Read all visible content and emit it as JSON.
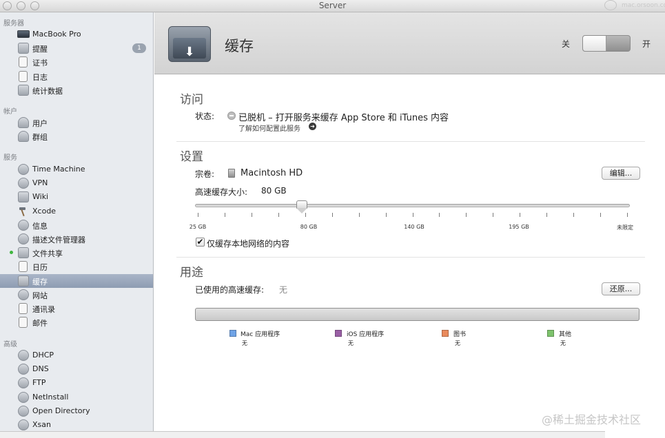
{
  "window": {
    "title": "Server",
    "watermark_logo_text": "mac.orsoon.com"
  },
  "sidebar": {
    "sections": [
      {
        "title": "服务器",
        "items": [
          {
            "label": "MacBook Pro",
            "icon": "laptop-icon"
          },
          {
            "label": "提醒",
            "icon": "megaphone-icon",
            "badge": "1"
          },
          {
            "label": "证书",
            "icon": "certificate-icon"
          },
          {
            "label": "日志",
            "icon": "log-icon"
          },
          {
            "label": "统计数据",
            "icon": "stats-icon"
          }
        ]
      },
      {
        "title": "帐户",
        "items": [
          {
            "label": "用户",
            "icon": "user-icon"
          },
          {
            "label": "群组",
            "icon": "group-icon"
          }
        ]
      },
      {
        "title": "服务",
        "items": [
          {
            "label": "Time Machine",
            "icon": "time-machine-icon"
          },
          {
            "label": "VPN",
            "icon": "vpn-icon"
          },
          {
            "label": "Wiki",
            "icon": "wiki-icon"
          },
          {
            "label": "Xcode",
            "icon": "hammer-icon"
          },
          {
            "label": "信息",
            "icon": "messages-icon"
          },
          {
            "label": "描述文件管理器",
            "icon": "profile-manager-icon"
          },
          {
            "label": "文件共享",
            "icon": "file-sharing-icon",
            "active_dot": true
          },
          {
            "label": "日历",
            "icon": "calendar-icon"
          },
          {
            "label": "缓存",
            "icon": "caching-icon",
            "selected": true
          },
          {
            "label": "网站",
            "icon": "globe-icon"
          },
          {
            "label": "通讯录",
            "icon": "contacts-icon"
          },
          {
            "label": "邮件",
            "icon": "mail-icon"
          }
        ]
      },
      {
        "title": "高级",
        "items": [
          {
            "label": "DHCP",
            "icon": "dhcp-icon"
          },
          {
            "label": "DNS",
            "icon": "dns-icon"
          },
          {
            "label": "FTP",
            "icon": "ftp-icon"
          },
          {
            "label": "NetInstall",
            "icon": "netinstall-icon"
          },
          {
            "label": "Open Directory",
            "icon": "open-directory-icon"
          },
          {
            "label": "Xsan",
            "icon": "xsan-icon"
          }
        ]
      }
    ]
  },
  "header": {
    "title": "缓存",
    "icon": "caching-download-icon",
    "switch_off_label": "关",
    "switch_on_label": "开",
    "switch_state": "off"
  },
  "access": {
    "heading": "访问",
    "status_label": "状态:",
    "status_text": "已脱机 – 打开服务来缓存 App Store 和 iTunes 内容",
    "help_link": "了解如何配置此服务"
  },
  "settings": {
    "heading": "设置",
    "volume_label": "宗卷:",
    "volume_value": "Macintosh HD",
    "edit_button": "编辑...",
    "cache_size_label": "高速缓存大小:",
    "cache_size_value": "80 GB",
    "slider_value_gb": 80,
    "slider_min_gb": 25,
    "slider_max_label": "未限定",
    "slider_labels": [
      "25 GB",
      "80 GB",
      "140 GB",
      "195 GB",
      "未限定"
    ],
    "local_only_checkbox_label": "仅缓存本地网络的内容",
    "local_only_checked": true
  },
  "usage": {
    "heading": "用途",
    "used_label": "已使用的高速缓存:",
    "used_value": "无",
    "reset_button": "还原...",
    "used_fraction": 0,
    "legend": [
      {
        "label": "Mac 应用程序",
        "value": "无",
        "color": "#6fa3e6"
      },
      {
        "label": "iOS 应用程序",
        "value": "无",
        "color": "#9a5fa5"
      },
      {
        "label": "图书",
        "value": "无",
        "color": "#e98a5c"
      },
      {
        "label": "其他",
        "value": "无",
        "color": "#7ec36d"
      }
    ]
  },
  "watermark": "@稀土掘金技术社区"
}
